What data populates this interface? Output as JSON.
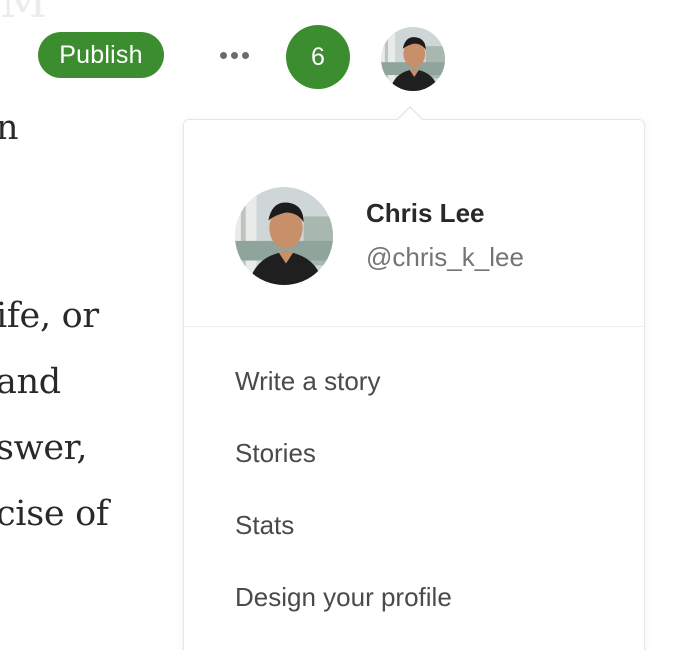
{
  "toolbar": {
    "publish_label": "Publish",
    "more_icon": "more-horizontal-icon",
    "notification_count": "6",
    "accent_color": "#3c8d2f"
  },
  "article": {
    "lines": [
      "n",
      "ife, or",
      "and",
      "swer,",
      "cise of"
    ]
  },
  "profile_menu": {
    "name": "Chris Lee",
    "handle": "@chris_k_lee",
    "items": [
      {
        "label": "Write a story"
      },
      {
        "label": "Stories"
      },
      {
        "label": "Stats"
      },
      {
        "label": "Design your profile"
      }
    ]
  }
}
